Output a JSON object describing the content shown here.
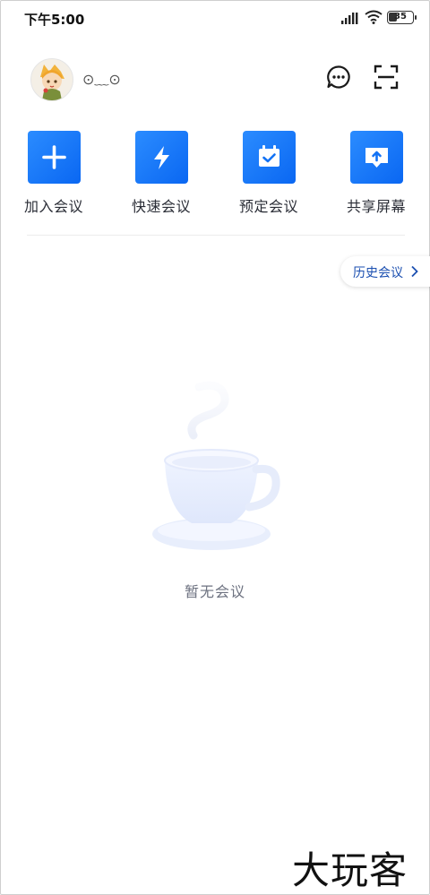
{
  "status_bar": {
    "time": "下午5:00",
    "battery": "35"
  },
  "profile": {
    "nickname": "⊙﹏⊙"
  },
  "header_icons": [
    "chat-icon",
    "scan-icon"
  ],
  "actions": [
    {
      "label": "加入会议",
      "icon": "plus-icon"
    },
    {
      "label": "快速会议",
      "icon": "lightning-icon"
    },
    {
      "label": "预定会议",
      "icon": "calendar-check-icon"
    },
    {
      "label": "共享屏幕",
      "icon": "share-screen-icon"
    }
  ],
  "history": {
    "label": "历史会议"
  },
  "empty_state": {
    "text": "暂无会议"
  },
  "watermark": {
    "text": "大玩客"
  },
  "colors": {
    "accent": "#0a67f2",
    "history_text": "#1b4fb0"
  }
}
